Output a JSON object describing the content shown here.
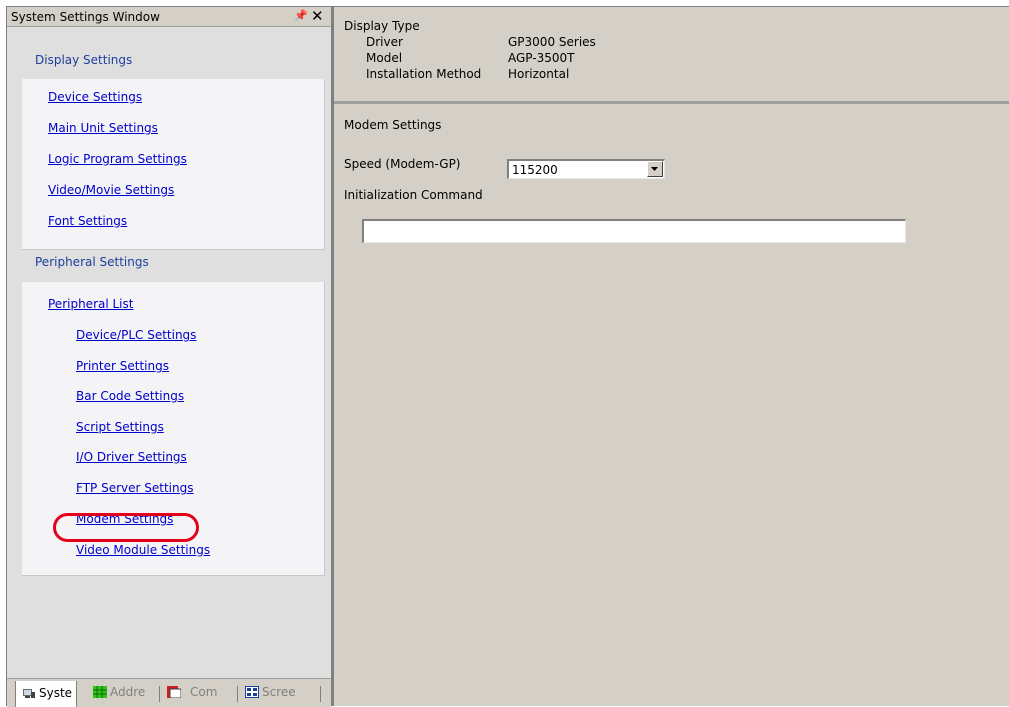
{
  "left_window": {
    "title": "System Settings Window",
    "pin_icon": "pin-icon",
    "close_icon": "close-icon",
    "display_section": {
      "heading": "Display Settings",
      "links": [
        "Device Settings",
        "Main Unit Settings",
        "Logic Program Settings",
        "Video/Movie Settings",
        "Font Settings"
      ]
    },
    "peripheral_section": {
      "heading": "Peripheral Settings",
      "list_link": "Peripheral List",
      "links": [
        "Device/PLC Settings",
        "Printer Settings",
        "Bar Code Settings",
        "Script Settings",
        "I/O Driver Settings",
        "FTP Server Settings",
        "Modem Settings",
        "Video Module Settings"
      ],
      "highlighted": "Modem Settings",
      "highlight_color": "#e4001b"
    },
    "tabs": [
      {
        "label": "Syste",
        "icon": "system-settings-icon",
        "active": true
      },
      {
        "label": "Addre",
        "icon": "address-grid-icon",
        "active": false
      },
      {
        "label": "Com",
        "icon": "common-settings-icon",
        "active": false
      },
      {
        "label": "Scree",
        "icon": "screen-list-icon",
        "active": false
      }
    ]
  },
  "display_type": {
    "heading": "Display Type",
    "rows": [
      {
        "label": "Driver",
        "value": "GP3000 Series"
      },
      {
        "label": "Model",
        "value": "AGP-3500T"
      },
      {
        "label": "Installation Method",
        "value": "Horizontal"
      }
    ]
  },
  "modem_settings": {
    "heading": "Modem Settings",
    "speed_label": "Speed (Modem-GP)",
    "speed_value": "115200",
    "init_label": "Initialization Command",
    "init_value": ""
  },
  "colors": {
    "link": "#0000cc",
    "section_heading": "#1c3f9c",
    "panel_bg": "#d4d0c8"
  }
}
